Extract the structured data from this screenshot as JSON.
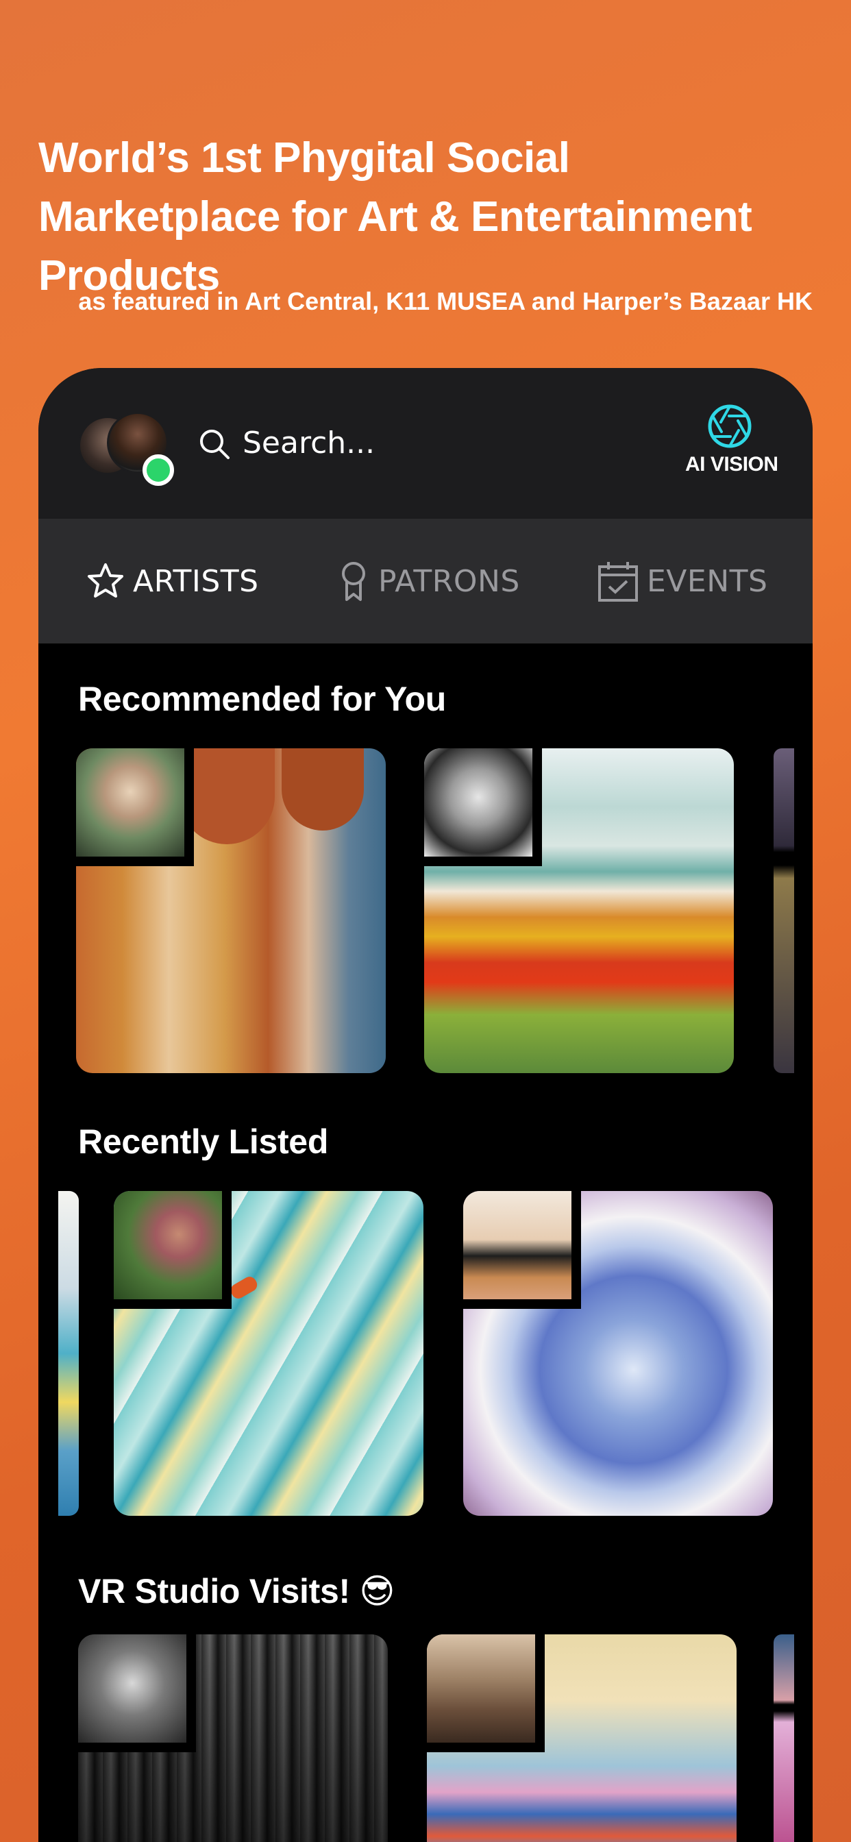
{
  "hero": {
    "title": "World’s 1st Phygital Social Marketplace for Art & Entertainment Products",
    "subtitle": "as featured in Art Central, K11 MUSEA and Harper’s Bazaar HK"
  },
  "topbar": {
    "search_placeholder": "Search...",
    "ai_vision_label": "AI VISION",
    "accent_color": "#2fd8e6",
    "online_color": "#2bd46a"
  },
  "tabs": [
    {
      "label": "ARTISTS",
      "icon": "star-icon",
      "active": true
    },
    {
      "label": "PATRONS",
      "icon": "award-ribbon-icon",
      "active": false
    },
    {
      "label": "EVENTS",
      "icon": "calendar-check-icon",
      "active": false
    }
  ],
  "sections": {
    "recommended": {
      "title": "Recommended for You"
    },
    "recent": {
      "title": "Recently Listed"
    },
    "vr": {
      "title": "VR Studio Visits! 😎"
    }
  },
  "colors": {
    "background_orange": "#e8702f",
    "panel_dark": "#1c1c1e",
    "tabbar": "#2c2c2e"
  }
}
